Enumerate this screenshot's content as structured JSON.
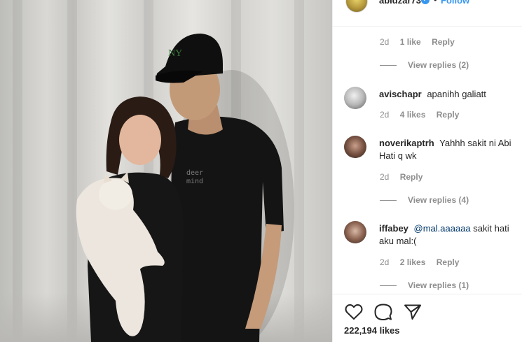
{
  "post": {
    "image_alt": "",
    "shirt_text": "deer\nmind",
    "cap_logo": "NY"
  },
  "header": {
    "username": "abidzar73",
    "separator": "•",
    "follow_label": "Follow"
  },
  "thread": {
    "top_meta": {
      "time": "2d",
      "likes": "1 like",
      "reply": "Reply"
    },
    "top_view_replies": "View replies (2)",
    "comments": [
      {
        "username": "avischapr",
        "mention": "",
        "text": "apanihh galiatt",
        "time": "2d",
        "likes": "4 likes",
        "reply": "Reply",
        "view_replies": ""
      },
      {
        "username": "noverikaptrh",
        "mention": "",
        "text": "Yahhh sakit ni Abi Hati q wk",
        "time": "2d",
        "likes": "",
        "reply": "Reply",
        "view_replies": "View replies (4)"
      },
      {
        "username": "iffabey",
        "mention": "@mal.aaaaaa",
        "text": "sakit hati aku mal:(",
        "time": "2d",
        "likes": "2 likes",
        "reply": "Reply",
        "view_replies": "View replies (1)"
      }
    ]
  },
  "actions": {
    "like_icon": "heart-icon",
    "comment_icon": "comment-icon",
    "share_icon": "share-icon",
    "likes_count": "222,194 likes"
  },
  "colors": {
    "link": "#3897f0",
    "muted": "#8e8e8e",
    "text": "#262626",
    "border": "#efefef"
  }
}
